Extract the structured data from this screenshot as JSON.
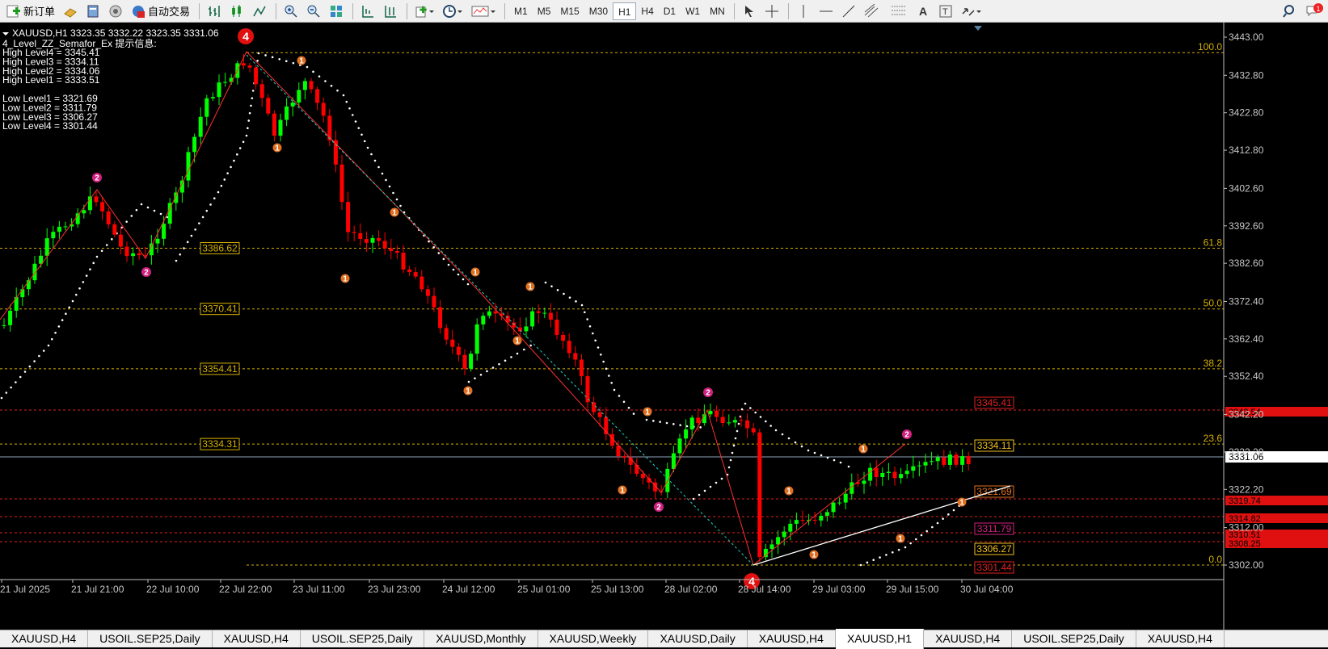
{
  "toolbar": {
    "new_order_label": "新订单",
    "auto_trade_label": "自动交易",
    "timeframes": [
      "M1",
      "M5",
      "M15",
      "M30",
      "H1",
      "H4",
      "D1",
      "W1",
      "MN"
    ],
    "active_timeframe": "H1"
  },
  "chart": {
    "header": "XAUUSD,H1  3323.35 3332.22 3323.35 3331.06",
    "indicator_title": "4_Level_ZZ_Semafor_Ex 提示信息:",
    "indicator_lines": [
      "High Level4 = 3345.41",
      "High Level3 = 3334.11",
      "High Level2 = 3334.06",
      "High Level1 = 3333.51",
      "",
      "Low Level1 = 3321.69",
      "Low Level2 = 3311.79",
      "Low Level3 = 3306.27",
      "Low Level4 = 3301.44"
    ],
    "y_ticks": [
      "3443.00",
      "3432.80",
      "3422.80",
      "3412.80",
      "3402.60",
      "3392.60",
      "3382.60",
      "3372.40",
      "3362.40",
      "3352.40",
      "3342.20",
      "3332.20",
      "3322.20",
      "3312.00",
      "3302.00"
    ],
    "x_ticks": [
      "21 Jul 2025",
      "21 Jul 21:00",
      "22 Jul 10:00",
      "22 Jul 22:00",
      "23 Jul 11:00",
      "23 Jul 23:00",
      "24 Jul 12:00",
      "25 Jul 01:00",
      "25 Jul 13:00",
      "28 Jul 02:00",
      "28 Jul 14:00",
      "29 Jul 03:00",
      "29 Jul 15:00",
      "30 Jul 04:00"
    ],
    "current_price": "3331.06",
    "fib_labels": [
      "100.0",
      "61.8",
      "50.0",
      "38.2",
      "23.6",
      "0.0"
    ],
    "fib_price_labels": [
      "3386.62",
      "3370.41",
      "3354.41",
      "3334.31"
    ],
    "semafor_levels": [
      "3345.41",
      "3334.11",
      "3321.69",
      "3311.79",
      "3306.27",
      "3301.44"
    ],
    "right_red_labels": [
      "3343.54",
      "3319.74",
      "3314.82",
      "3310.51",
      "3308.25"
    ],
    "semafor_marks": [
      "4",
      "2",
      "1",
      "2",
      "1",
      "4"
    ],
    "colors": {
      "bull": "#00ff00",
      "bear": "#ff0000",
      "fib": "#d4b000",
      "zigzag": "#ff3030",
      "dots": "#ffffff"
    }
  },
  "tabs": [
    "XAUUSD,H4",
    "USOIL.SEP25,Daily",
    "XAUUSD,H4",
    "USOIL.SEP25,Daily",
    "XAUUSD,Monthly",
    "XAUUSD,Weekly",
    "XAUUSD,Daily",
    "XAUUSD,H4",
    "XAUUSD,H1",
    "XAUUSD,H4",
    "USOIL.SEP25,Daily",
    "XAUUSD,H4"
  ],
  "active_tab": "XAUUSD,H1"
}
